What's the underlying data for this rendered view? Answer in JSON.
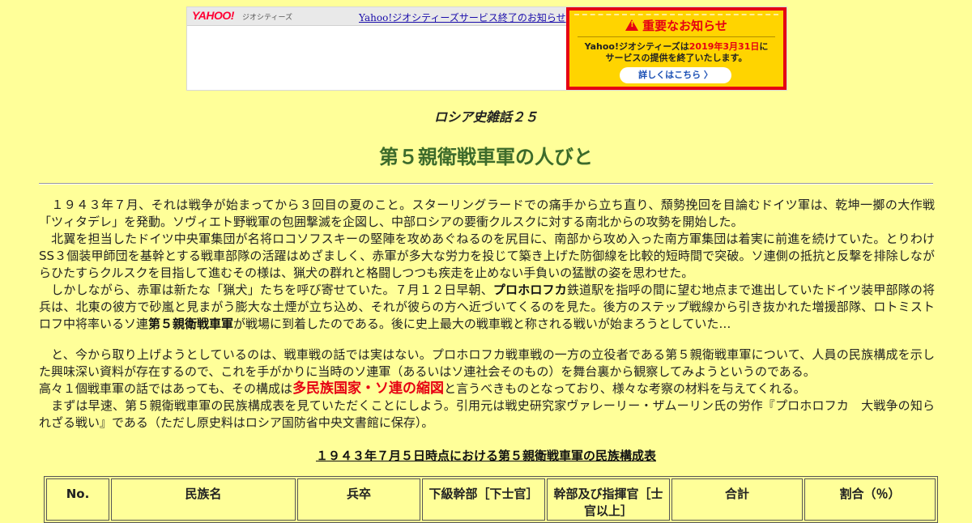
{
  "banner": {
    "logo": "YAHOO!",
    "logo_sub": "ジオシティーズ",
    "link_text": "Yahoo!ジオシティーズサービス終了のお知らせ",
    "notice": {
      "title": "重要なお知らせ",
      "line1_a": "Yahoo!ジオシティーズは",
      "line1_date": "2019年3月31日",
      "line1_b": "に",
      "line2": "サービスの提供を終了いたします。",
      "button": "詳しくはこちら 〉"
    }
  },
  "page": {
    "subtitle": "ロシア史雑話２５",
    "title": "第５親衛戦車軍の人びと"
  },
  "paragraphs": {
    "p1": "　１９４３年７月、それは戦争が始まってから３回目の夏のこと。スターリングラードでの痛手から立ち直り、頽勢挽回を目論むドイツ軍は、乾坤一擲の大作戦「ツィタデレ」を発動。ソヴィエト野戦軍の包囲撃滅を企図し、中部ロシアの要衝クルスクに対する南北からの攻勢を開始した。",
    "p2": "　北翼を担当したドイツ中央軍集団が名将ロコソフスキーの堅陣を攻めあぐねるのを尻目に、南部から攻め入った南方軍集団は着実に前進を続けていた。とりわけSS３個装甲師団を基幹とする戦車部隊の活躍はめざましく、赤軍が多大な労力を投じて築き上げた防御線を比較的短時間で突破。ソ連側の抵抗と反撃を排除しながらひたすらクルスクを目指して進むその様は、猟犬の群れと格闘しつつも疾走を止めない手負いの猛獣の姿を思わせた。",
    "p3_a": "　しかしながら、赤軍は新たな「猟犬」たちを呼び寄せていた。７月１２日早朝、",
    "p3_b": "プロホロフカ",
    "p3_c": "鉄道駅を指呼の間に望む地点まで進出していたドイツ装甲部隊の将兵は、北東の彼方で砂嵐と見まがう膨大な土煙が立ち込め、それが彼らの方へ近づいてくるのを見た。後方のステップ戦線から引き抜かれた増援部隊、ロトミストロフ中将率いるソ連",
    "p3_d": "第５親衛戦車軍",
    "p3_e": "が戦場に到着したのである。後に史上最大の戦車戦と称される戦いが始まろうとしていた…",
    "p4": "　と、今から取り上げようとしているのは、戦車戦の話では実はない。プロホロフカ戦車戦の一方の立役者である第５親衛戦車軍について、人員の民族構成を示した興味深い資料が存在するので、これを手がかりに当時のソ連軍（あるいはソ連社会そのもの）を舞台裏から観察してみようというのである。",
    "p5_a": "高々１個戦車軍の話ではあっても、その構成は",
    "p5_b": "多民族国家・ソ連の縮図",
    "p5_c": "と言うべきものとなっており、様々な考察の材料を与えてくれる。",
    "p6": "　まずは早速、第５親衛戦車軍の民族構成表を見ていただくことにしよう。引用元は戦史研究家ヴァレーリー・ザムーリン氏の労作『プロホロフカ　大戦争の知られざる戦い』である（ただし原史料はロシア国防省中央文書館に保存）。"
  },
  "table": {
    "caption": "１９４３年７月５日時点における第５親衛戦車軍の民族構成表",
    "headers": [
      "No.",
      "民族名",
      "兵卒",
      "下級幹部［下士官］",
      "幹部及び指揮官［士官以上］",
      "合計",
      "割合（％）"
    ]
  },
  "colors": {
    "background": "#ffff99",
    "title_green": "#3d6b2b",
    "highlight_red": "#e60012",
    "notice_yellow": "#ffd400"
  }
}
